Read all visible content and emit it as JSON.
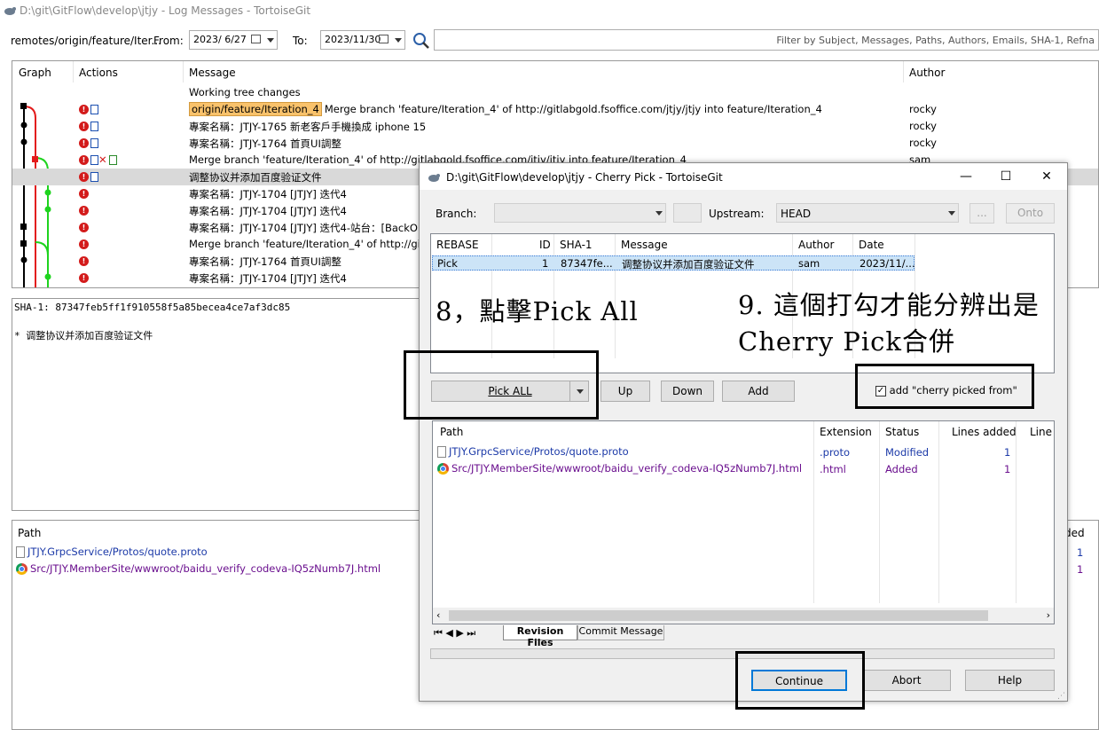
{
  "window": {
    "title": "D:\\git\\GitFlow\\develop\\jtjy - Log Messages - TortoiseGit"
  },
  "toolbar": {
    "branch": "remotes/origin/feature/Iter...",
    "from_label": "From:",
    "from_date": "2023/ 6/27",
    "to_label": "To:",
    "to_date": "2023/11/30",
    "filter_placeholder": "Filter by Subject, Messages, Paths, Authors, Emails, SHA-1, Refna"
  },
  "log": {
    "columns": [
      "Graph",
      "Actions",
      "Message",
      "Author"
    ],
    "rows": [
      {
        "tag": "",
        "message": "Working tree changes",
        "author": ""
      },
      {
        "tag": "origin/feature/Iteration_4",
        "message": "Merge branch 'feature/Iteration_4' of http://gitlabgold.fsoffice.com/jtjy/jtjy into feature/Iteration_4",
        "author": "rocky"
      },
      {
        "tag": "",
        "message": "專案名稱：JTJY-1765 新老客戶手機換成 iphone 15",
        "author": "rocky"
      },
      {
        "tag": "",
        "message": "專案名稱：JTJY-1764 首頁UI調整",
        "author": "rocky"
      },
      {
        "tag": "",
        "message": "Merge branch 'feature/Iteration_4' of http://gitlabgold.fsoffice.com/jtjy/jtjy into feature/Iteration_4",
        "author": "sam"
      },
      {
        "tag": "",
        "message": "调整协议并添加百度验证文件",
        "author": ""
      },
      {
        "tag": "",
        "message": "專案名稱：JTJY-1704 [JTJY] 迭代4",
        "author": ""
      },
      {
        "tag": "",
        "message": "專案名稱：JTJY-1704 [JTJY] 迭代4",
        "author": ""
      },
      {
        "tag": "",
        "message": "專案名稱：JTJY-1704 [JTJY] 迭代4-站台：[BackO",
        "author": ""
      },
      {
        "tag": "",
        "message": "Merge branch 'feature/Iteration_4' of http://gitlab",
        "author": ""
      },
      {
        "tag": "",
        "message": "專案名稱：JTJY-1764 首頁UI調整",
        "author": ""
      },
      {
        "tag": "",
        "message": "專案名稱：JTJY-1704 [JTJY] 迭代4",
        "author": ""
      }
    ]
  },
  "detail": {
    "sha": "SHA-1: 87347feb5ff1f910558f5a85becea4ce7af3dc85",
    "message": "* 调整协议并添加百度验证文件"
  },
  "paths_panel": {
    "header": "Path",
    "header_right": "ded",
    "files": [
      {
        "icon": "file-icon",
        "path": "JTJY.GrpcService/Protos/quote.proto",
        "count": "1"
      },
      {
        "icon": "chrome-icon",
        "path": "Src/JTJY.MemberSite/wwwroot/baidu_verify_codeva-IQ5zNumb7J.html",
        "count": "1"
      }
    ]
  },
  "cherry_pick": {
    "title": "D:\\git\\GitFlow\\develop\\jtjy - Cherry Pick - TortoiseGit",
    "branch_label": "Branch:",
    "upstream_label": "Upstream:",
    "upstream_value": "HEAD",
    "more_label": "...",
    "onto_label": "Onto",
    "commit_columns": [
      "REBASE",
      "ID",
      "SHA-1",
      "Message",
      "Author",
      "Date"
    ],
    "commits": [
      {
        "rebase": "Pick",
        "id": "1",
        "sha": "87347fe...",
        "message": "调整协议并添加百度验证文件",
        "author": "sam",
        "date": "2023/11/..."
      }
    ],
    "pick_all_label": "Pick ALL",
    "up_label": "Up",
    "down_label": "Down",
    "add_label": "Add",
    "checkbox_label": "add \"cherry picked from\"",
    "checkbox_checked": true,
    "file_columns": [
      "Path",
      "Extension",
      "Status",
      "Lines added",
      "Line"
    ],
    "files": [
      {
        "icon": "file-icon",
        "path": "JTJY.GrpcService/Protos/quote.proto",
        "ext": ".proto",
        "status": "Modified",
        "lines": "1"
      },
      {
        "icon": "chrome-icon",
        "path": "Src/JTJY.MemberSite/wwwroot/baidu_verify_codeva-IQ5zNumb7J.html",
        "ext": ".html",
        "status": "Added",
        "lines": "1"
      }
    ],
    "tabs": [
      "Revision Files",
      "Commit Message"
    ],
    "continue_label": "Continue",
    "abort_label": "Abort",
    "help_label": "Help"
  },
  "annotations": {
    "step8": "8，點擊Pick All",
    "step9_line1": "9. 這個打勾才能分辨出是",
    "step9_line2": "Cherry Pick合併"
  },
  "colors": {
    "link": "#0b5fc4",
    "tag_bg": "#f9c26b",
    "selected_row": "#d9d9d9",
    "graph_red": "#e31b1b",
    "graph_green": "#1ed31e"
  }
}
